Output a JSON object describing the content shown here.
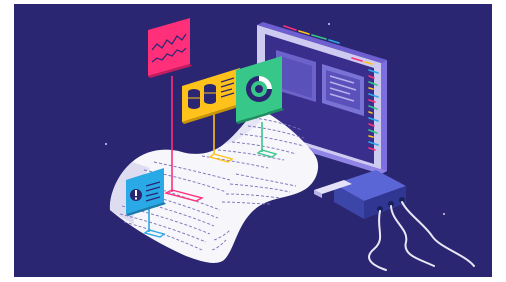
{
  "illustration": {
    "background_color": "#2b2671",
    "palette": {
      "pink": "#ff2f7a",
      "yellow": "#ffc21a",
      "green": "#36c789",
      "blue": "#29a9e6",
      "paper": "#f7f7fb",
      "monitor": "#c9c4ee",
      "screen": "#3d2f93",
      "device": "#4b56c7"
    },
    "cards": [
      {
        "name": "line-chart-card",
        "color": "pink"
      },
      {
        "name": "database-card",
        "color": "yellow"
      },
      {
        "name": "pie-chart-card",
        "color": "green"
      },
      {
        "name": "alert-card",
        "color": "blue"
      }
    ],
    "icons": [
      "line-chart-icon",
      "database-icon",
      "pie-chart-icon",
      "exclamation-icon"
    ]
  }
}
